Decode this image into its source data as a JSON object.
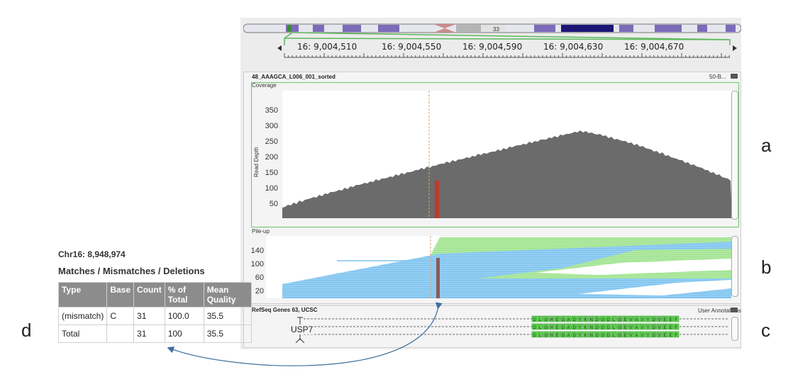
{
  "ideogram": {
    "band_label": "33"
  },
  "ruler": {
    "labels": [
      "16: 9,004,510",
      "16: 9,004,550",
      "16: 9,004,590",
      "16: 9,004,630",
      "16: 9,004,670"
    ]
  },
  "alignment_track": {
    "title": "48_AAAGCA_L006_001_sorted",
    "right_label": "50-B...",
    "coverage": {
      "title": "Coverage",
      "y_axis_label": "Read Depth",
      "y_ticks": [
        "350",
        "300",
        "250",
        "200",
        "150",
        "100",
        "50"
      ]
    },
    "pileup": {
      "title": "Pile-up",
      "y_ticks": [
        "140",
        "100",
        "60",
        "20"
      ]
    }
  },
  "genes_track": {
    "title": "RefSeq Genes 63, UCSC",
    "right_label": "User Annotations",
    "gene_name": "USP7",
    "sequence": "DLGHEGADYKNDGDLGEVAVYDVEEF"
  },
  "info_panel": {
    "position": "Chr16: 8,948,974",
    "heading": "Matches / Mismatches / Deletions",
    "columns": [
      "Type",
      "Base",
      "Count",
      "% of Total",
      "Mean Quality"
    ],
    "rows": [
      [
        "(mismatch)",
        "C",
        "31",
        "100.0",
        "35.5"
      ],
      [
        "Total",
        "",
        "31",
        "100",
        "35.5"
      ]
    ]
  },
  "panel_labels": {
    "a": "a",
    "b": "b",
    "c": "c",
    "d": "d"
  },
  "colors": {
    "coverage_fill": "#6b6b6b",
    "mismatch": "#c0392b",
    "read_forward": "#7ec3ef",
    "read_reverse": "#9fe38e",
    "zoom_outline": "#5cb85c",
    "arrow": "#3d6e9e"
  }
}
